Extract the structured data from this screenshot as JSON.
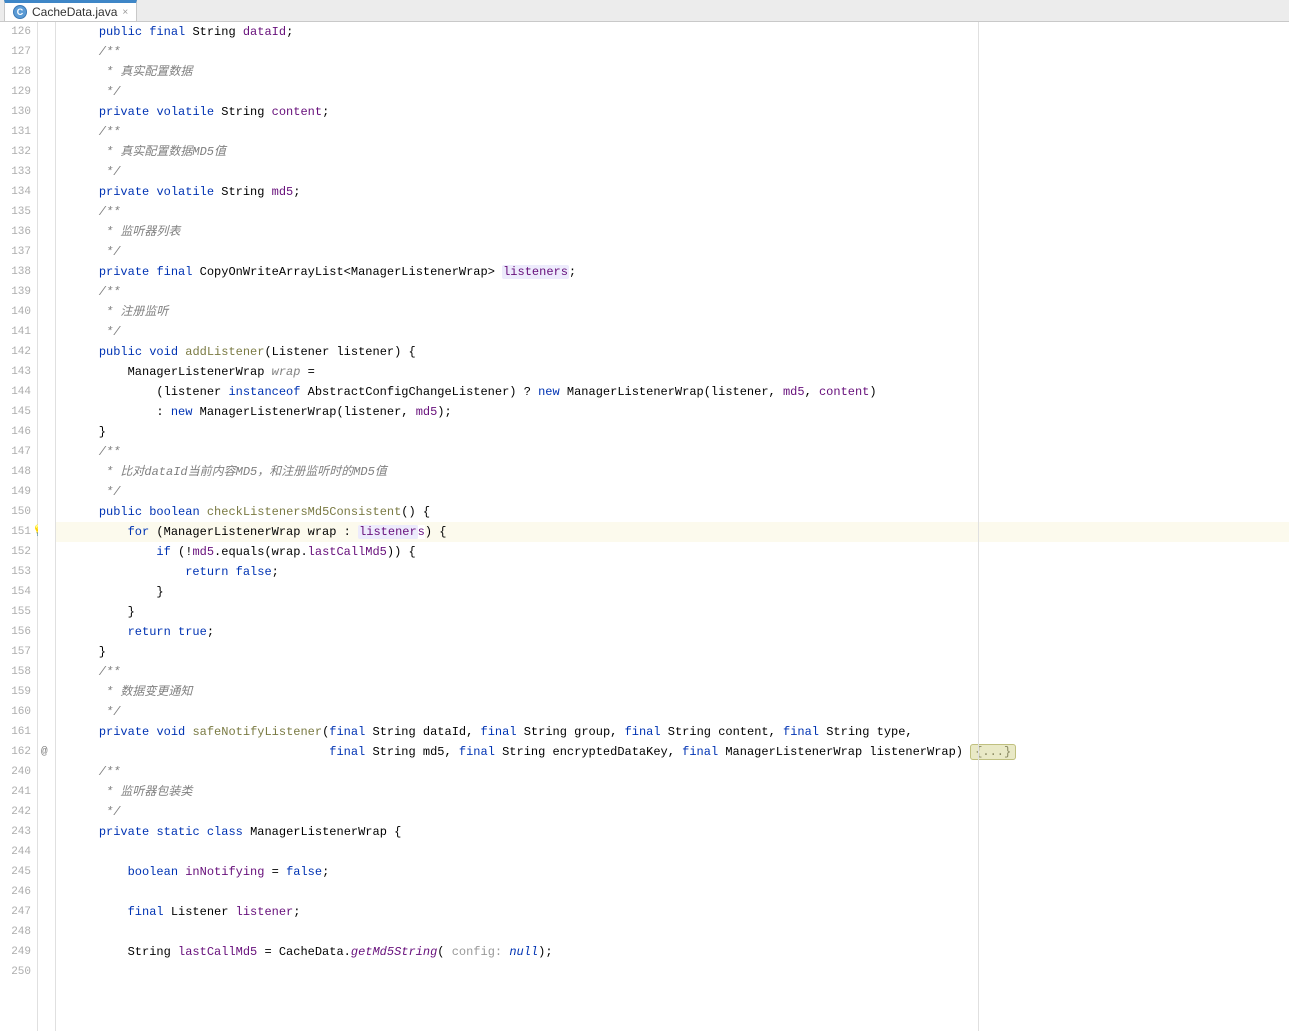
{
  "tab": {
    "filename": "CacheData.java",
    "icon_letter": "C",
    "close_glyph": "×"
  },
  "line_numbers": [
    "126",
    "127",
    "128",
    "129",
    "130",
    "131",
    "132",
    "133",
    "134",
    "135",
    "136",
    "137",
    "138",
    "139",
    "140",
    "141",
    "142",
    "143",
    "144",
    "145",
    "146",
    "147",
    "148",
    "149",
    "150",
    "151",
    "152",
    "153",
    "154",
    "155",
    "156",
    "157",
    "158",
    "159",
    "160",
    "161",
    "162",
    "240",
    "241",
    "242",
    "243",
    "244",
    "245",
    "246",
    "247",
    "248",
    "249",
    "250"
  ],
  "annotation_row": {
    "index": 36,
    "symbol": "@"
  },
  "bulb_row": 25,
  "highlighted_row": 25,
  "fold_badge": "{...}",
  "code_lines": {
    "l0": [
      {
        "t": "    "
      },
      {
        "t": "public",
        "c": "kw"
      },
      {
        "t": " "
      },
      {
        "t": "final",
        "c": "kw"
      },
      {
        "t": " String "
      },
      {
        "t": "dataId",
        "c": "fld"
      },
      {
        "t": ";"
      }
    ],
    "l1": [
      {
        "t": "    /**",
        "c": "com"
      }
    ],
    "l2": [
      {
        "t": "     * 真实配置数据",
        "c": "com"
      }
    ],
    "l3": [
      {
        "t": "     */",
        "c": "com"
      }
    ],
    "l4": [
      {
        "t": "    "
      },
      {
        "t": "private",
        "c": "kw"
      },
      {
        "t": " "
      },
      {
        "t": "volatile",
        "c": "kw"
      },
      {
        "t": " String "
      },
      {
        "t": "content",
        "c": "fld"
      },
      {
        "t": ";"
      }
    ],
    "l5": [
      {
        "t": "    /**",
        "c": "com"
      }
    ],
    "l6": [
      {
        "t": "     * 真实配置数据MD5值",
        "c": "com"
      }
    ],
    "l7": [
      {
        "t": "     */",
        "c": "com"
      }
    ],
    "l8": [
      {
        "t": "    "
      },
      {
        "t": "private",
        "c": "kw"
      },
      {
        "t": " "
      },
      {
        "t": "volatile",
        "c": "kw"
      },
      {
        "t": " String "
      },
      {
        "t": "md5",
        "c": "fld"
      },
      {
        "t": ";"
      }
    ],
    "l9": [
      {
        "t": "    /**",
        "c": "com"
      }
    ],
    "l10": [
      {
        "t": "     * 监听器列表",
        "c": "com"
      }
    ],
    "l11": [
      {
        "t": "     */",
        "c": "com"
      }
    ],
    "l12": [
      {
        "t": "    "
      },
      {
        "t": "private",
        "c": "kw"
      },
      {
        "t": " "
      },
      {
        "t": "final",
        "c": "kw"
      },
      {
        "t": " CopyOnWriteArrayList<ManagerListenerWrap> "
      },
      {
        "t": "listeners",
        "c": "fld usage"
      },
      {
        "t": ";"
      }
    ],
    "l13": [
      {
        "t": "    /**",
        "c": "com"
      }
    ],
    "l14": [
      {
        "t": "     * 注册监听",
        "c": "com"
      }
    ],
    "l15": [
      {
        "t": "     */",
        "c": "com"
      }
    ],
    "l16": [
      {
        "t": "    "
      },
      {
        "t": "public",
        "c": "kw"
      },
      {
        "t": " "
      },
      {
        "t": "void",
        "c": "kw"
      },
      {
        "t": " "
      },
      {
        "t": "addListener",
        "c": "mtd"
      },
      {
        "t": "(Listener listener) {"
      }
    ],
    "l17": [
      {
        "t": "        ManagerListenerWrap "
      },
      {
        "t": "wrap",
        "c": "com"
      },
      {
        "t": " ="
      }
    ],
    "l18": [
      {
        "t": "            (listener "
      },
      {
        "t": "instanceof",
        "c": "kw"
      },
      {
        "t": " AbstractConfigChangeListener) ? "
      },
      {
        "t": "new",
        "c": "kw"
      },
      {
        "t": " ManagerListenerWrap(listener, "
      },
      {
        "t": "md5",
        "c": "fld"
      },
      {
        "t": ", "
      },
      {
        "t": "content",
        "c": "fld"
      },
      {
        "t": ")"
      }
    ],
    "l19": [
      {
        "t": "            : "
      },
      {
        "t": "new",
        "c": "kw"
      },
      {
        "t": " ManagerListenerWrap(listener, "
      },
      {
        "t": "md5",
        "c": "fld"
      },
      {
        "t": ");"
      }
    ],
    "l20": [
      {
        "t": "    }"
      }
    ],
    "l21": [
      {
        "t": "    /**",
        "c": "com"
      }
    ],
    "l22": [
      {
        "t": "     * 比对dataId当前内容MD5，和注册监听时的MD5值",
        "c": "com"
      }
    ],
    "l23": [
      {
        "t": "     */",
        "c": "com"
      }
    ],
    "l24": [
      {
        "t": "    "
      },
      {
        "t": "public",
        "c": "kw"
      },
      {
        "t": " "
      },
      {
        "t": "boolean",
        "c": "kw"
      },
      {
        "t": " "
      },
      {
        "t": "checkListenersMd5Consistent",
        "c": "mtd"
      },
      {
        "t": "() {"
      }
    ],
    "l25": [
      {
        "t": "        "
      },
      {
        "t": "for",
        "c": "kw"
      },
      {
        "t": " (ManagerListenerWrap wrap : "
      },
      {
        "t": "listener",
        "c": "fld usage"
      },
      {
        "t": "s",
        "c": "fld caret"
      },
      {
        "t": ") {"
      }
    ],
    "l26": [
      {
        "t": "            "
      },
      {
        "t": "if",
        "c": "kw"
      },
      {
        "t": " (!"
      },
      {
        "t": "md5",
        "c": "fld"
      },
      {
        "t": ".equals(wrap."
      },
      {
        "t": "lastCallMd5",
        "c": "fld"
      },
      {
        "t": ")) {"
      }
    ],
    "l27": [
      {
        "t": "                "
      },
      {
        "t": "return",
        "c": "kw"
      },
      {
        "t": " "
      },
      {
        "t": "false",
        "c": "kw"
      },
      {
        "t": ";"
      }
    ],
    "l28": [
      {
        "t": "            }"
      }
    ],
    "l29": [
      {
        "t": "        }"
      }
    ],
    "l30": [
      {
        "t": "        "
      },
      {
        "t": "return",
        "c": "kw"
      },
      {
        "t": " "
      },
      {
        "t": "true",
        "c": "kw"
      },
      {
        "t": ";"
      }
    ],
    "l31": [
      {
        "t": "    }"
      }
    ],
    "l32": [
      {
        "t": "    /**",
        "c": "com"
      }
    ],
    "l33": [
      {
        "t": "     * 数据变更通知",
        "c": "com"
      }
    ],
    "l34": [
      {
        "t": "     */",
        "c": "com"
      }
    ],
    "l35": [
      {
        "t": "    "
      },
      {
        "t": "private",
        "c": "kw"
      },
      {
        "t": " "
      },
      {
        "t": "void",
        "c": "kw"
      },
      {
        "t": " "
      },
      {
        "t": "safeNotifyListener",
        "c": "mtd"
      },
      {
        "t": "("
      },
      {
        "t": "final",
        "c": "kw"
      },
      {
        "t": " String dataId, "
      },
      {
        "t": "final",
        "c": "kw"
      },
      {
        "t": " String group, "
      },
      {
        "t": "final",
        "c": "kw"
      },
      {
        "t": " String content, "
      },
      {
        "t": "final",
        "c": "kw"
      },
      {
        "t": " String type,"
      }
    ],
    "l36": [
      {
        "t": "                                    "
      },
      {
        "t": "final",
        "c": "kw"
      },
      {
        "t": " String md5, "
      },
      {
        "t": "final",
        "c": "kw"
      },
      {
        "t": " String encryptedDataKey, "
      },
      {
        "t": "final",
        "c": "kw"
      },
      {
        "t": " ManagerListenerWrap listenerWrap) "
      },
      {
        "t": "{...}",
        "c": "fold-badge"
      }
    ],
    "l37": [
      {
        "t": "    /**",
        "c": "com"
      }
    ],
    "l38": [
      {
        "t": "     * 监听器包装类",
        "c": "com"
      }
    ],
    "l39": [
      {
        "t": "     */",
        "c": "com"
      }
    ],
    "l40": [
      {
        "t": "    "
      },
      {
        "t": "private",
        "c": "kw"
      },
      {
        "t": " "
      },
      {
        "t": "static",
        "c": "kw"
      },
      {
        "t": " "
      },
      {
        "t": "class",
        "c": "kw"
      },
      {
        "t": " ManagerListenerWrap {"
      }
    ],
    "l41": [
      {
        "t": ""
      }
    ],
    "l42": [
      {
        "t": "        "
      },
      {
        "t": "boolean",
        "c": "kw"
      },
      {
        "t": " "
      },
      {
        "t": "inNotifying",
        "c": "fld"
      },
      {
        "t": " = "
      },
      {
        "t": "false",
        "c": "kw"
      },
      {
        "t": ";"
      }
    ],
    "l43": [
      {
        "t": ""
      }
    ],
    "l44": [
      {
        "t": "        "
      },
      {
        "t": "final",
        "c": "kw"
      },
      {
        "t": " Listener "
      },
      {
        "t": "listener",
        "c": "fld"
      },
      {
        "t": ";"
      }
    ],
    "l45": [
      {
        "t": ""
      }
    ],
    "l46": [
      {
        "t": "        String "
      },
      {
        "t": "lastCallMd5",
        "c": "fld"
      },
      {
        "t": " = CacheData."
      },
      {
        "t": "getMd5String",
        "c": "itm"
      },
      {
        "t": "( "
      },
      {
        "t": "config: ",
        "c": "param-hint"
      },
      {
        "t": "null",
        "c": "lit"
      },
      {
        "t": ");"
      }
    ],
    "l47": [
      {
        "t": ""
      }
    ]
  }
}
